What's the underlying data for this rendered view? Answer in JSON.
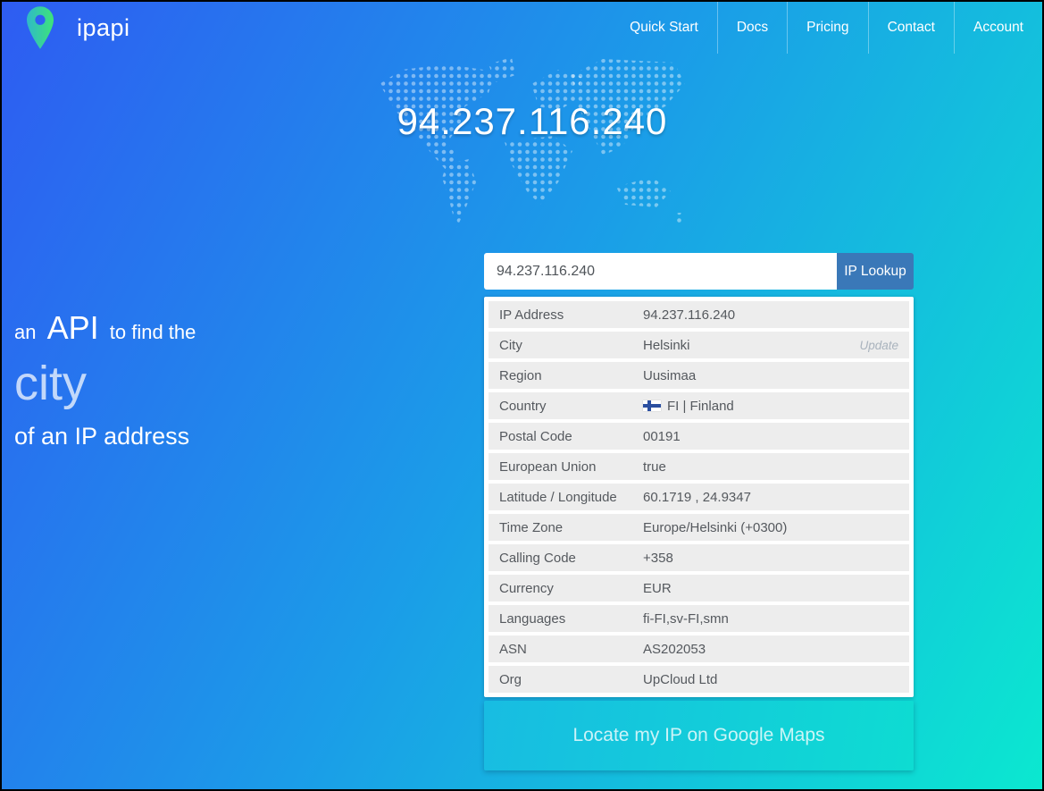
{
  "header": {
    "logo_text": "ipapi",
    "nav": [
      {
        "label": "Quick Start"
      },
      {
        "label": "Docs"
      },
      {
        "label": "Pricing"
      },
      {
        "label": "Contact"
      },
      {
        "label": "Account"
      }
    ]
  },
  "hero": {
    "ip_overlay": "94.237.116.240",
    "tagline_prefix": "an",
    "tagline_api": "API",
    "tagline_suffix": "to find the",
    "tagline_highlight": "city",
    "tagline_line3": "of an IP address"
  },
  "lookup": {
    "input_value": "94.237.116.240",
    "button_label": "IP Lookup"
  },
  "result_table": {
    "rows": [
      {
        "label": "IP Address",
        "value": "94.237.116.240"
      },
      {
        "label": "City",
        "value": "Helsinki",
        "action": "Update"
      },
      {
        "label": "Region",
        "value": "Uusimaa"
      },
      {
        "label": "Country",
        "value": "FI | Finland",
        "flag": "finland-flag"
      },
      {
        "label": "Postal Code",
        "value": "00191"
      },
      {
        "label": "European Union",
        "value": "true"
      },
      {
        "label": "Latitude / Longitude",
        "value": "60.1719 , 24.9347"
      },
      {
        "label": "Time Zone",
        "value": "Europe/Helsinki (+0300)"
      },
      {
        "label": "Calling Code",
        "value": "+358"
      },
      {
        "label": "Currency",
        "value": "EUR"
      },
      {
        "label": "Languages",
        "value": "fi-FI,sv-FI,smn"
      },
      {
        "label": "ASN",
        "value": "AS202053"
      },
      {
        "label": "Org",
        "value": "UpCloud Ltd"
      }
    ]
  },
  "footer_button": {
    "label": "Locate my IP on Google Maps"
  },
  "colors": {
    "bg_gradient_start": "#2e5cf2",
    "bg_gradient_end": "#0be8d0",
    "lookup_button": "#3a78b8",
    "row_background": "#ededed",
    "text_gray": "#55595e",
    "flag_blue": "#2b4fa0",
    "maps_panel_start": "#18bce2",
    "maps_panel_end": "#0edcd2"
  }
}
